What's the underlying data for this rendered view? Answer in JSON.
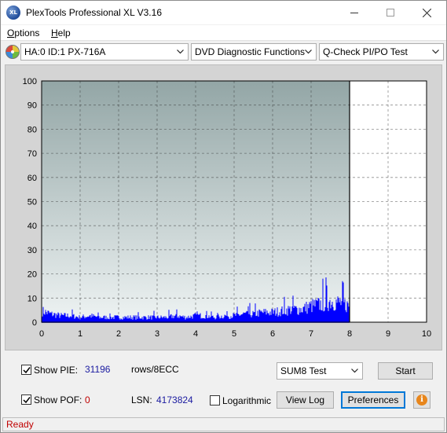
{
  "window": {
    "title": "PlexTools Professional XL V3.16",
    "icon_text": "XL"
  },
  "menu": [
    {
      "label": "Options",
      "accel": "O",
      "rest": "ptions"
    },
    {
      "label": "Help",
      "accel": "H",
      "rest": "elp"
    }
  ],
  "toolbar": {
    "drive": "HA:0 ID:1  PX-716A",
    "function": "DVD Diagnostic Functions",
    "test": "Q-Check PI/PO Test"
  },
  "chart_data": {
    "type": "bar",
    "title": "",
    "xlabel": "",
    "ylabel": "",
    "xlim": [
      0,
      10
    ],
    "ylim": [
      0,
      100
    ],
    "x_ticks": [
      "0",
      "1",
      "2",
      "3",
      "4",
      "5",
      "6",
      "7",
      "8",
      "9",
      "10"
    ],
    "y_ticks": [
      "0",
      "10",
      "20",
      "30",
      "40",
      "50",
      "60",
      "70",
      "80",
      "90",
      "100"
    ],
    "grid": true,
    "data_end_x": 8,
    "series": [
      {
        "name": "PIE",
        "color": "#0000ff",
        "x": [
          0.0,
          0.25,
          0.5,
          0.75,
          1.0,
          1.25,
          1.5,
          1.75,
          2.0,
          2.25,
          2.5,
          2.75,
          3.0,
          3.25,
          3.5,
          3.75,
          4.0,
          4.25,
          4.5,
          4.75,
          5.0,
          5.25,
          5.5,
          5.75,
          6.0,
          6.25,
          6.5,
          6.75,
          7.0,
          7.25,
          7.5,
          7.75,
          8.0
        ],
        "values": [
          7,
          5,
          4,
          4,
          3,
          4,
          3,
          3,
          3,
          3,
          3,
          3,
          3,
          3,
          4,
          3,
          4,
          4,
          3,
          4,
          4,
          5,
          5,
          6,
          6,
          7,
          8,
          8,
          10,
          11,
          13,
          12,
          10
        ]
      },
      {
        "name": "POF",
        "color": "#0000ff",
        "x": [
          0,
          8
        ],
        "values": [
          0,
          0
        ]
      }
    ]
  },
  "controls": {
    "show_pie_label": "Show PIE:",
    "show_pie_accel": "I",
    "pie_value": "31196",
    "pie_unit": "rows/8ECC",
    "show_pof_label": "Show POF:",
    "pof_value": "0",
    "lsn_label": "LSN:",
    "lsn_value": "4173824",
    "logarithmic_label": "Logarithmic",
    "sum_select": "SUM8 Test",
    "start_button": "Start",
    "view_log_button": "View Log",
    "preferences_button": "Preferences",
    "info_icon": "i"
  },
  "status": {
    "text": "Ready"
  }
}
